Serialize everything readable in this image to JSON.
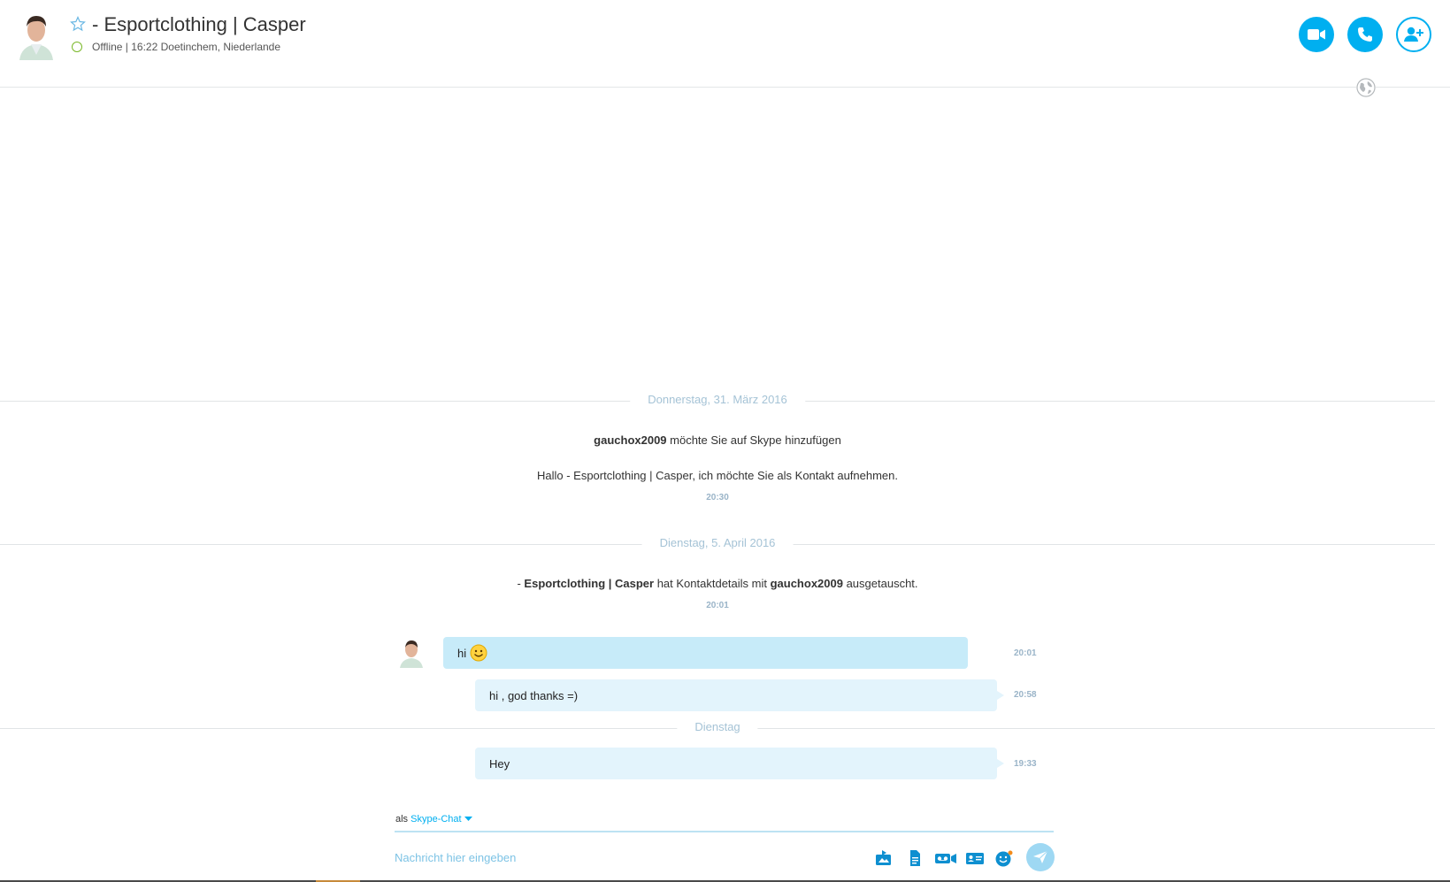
{
  "header": {
    "title": "- Esportclothing | Casper",
    "status": "Offline  |  16:22 Doetinchem, Niederlande",
    "colors": {
      "accent": "#00aff0",
      "presence": "#7ab829"
    }
  },
  "conversation": {
    "days": [
      {
        "label": "Donnerstag, 31. März 2016"
      },
      {
        "label": "Dienstag, 5. April 2016"
      },
      {
        "label": "Dienstag"
      }
    ],
    "system_messages": [
      {
        "bold": "gauchox2009",
        "text": " möchte Sie auf Skype hinzufügen"
      },
      {
        "text": "Hallo - Esportclothing | Casper, ich möchte Sie als Kontakt aufnehmen.",
        "time": "20:30"
      },
      {
        "prefix": "- ",
        "bold1": "Esportclothing | Casper",
        "middle": " hat Kontaktdetails mit ",
        "bold2": "gauchox2009",
        "suffix": " ausgetauscht.",
        "time": "20:01"
      }
    ],
    "messages": [
      {
        "text": "hi",
        "emoticon": "smiley-emoticon",
        "time": "20:01"
      },
      {
        "text": "hi , god thanks =)",
        "time": "20:58"
      },
      {
        "text": "Hey",
        "time": "19:33"
      }
    ]
  },
  "composer": {
    "mode_prefix": "als",
    "mode_label": "Skype-Chat",
    "placeholder": "Nachricht hier eingeben",
    "tools": [
      "image-send-icon",
      "file-icon",
      "video-message-icon",
      "contact-card-icon",
      "emoticon-icon",
      "send-icon"
    ]
  }
}
